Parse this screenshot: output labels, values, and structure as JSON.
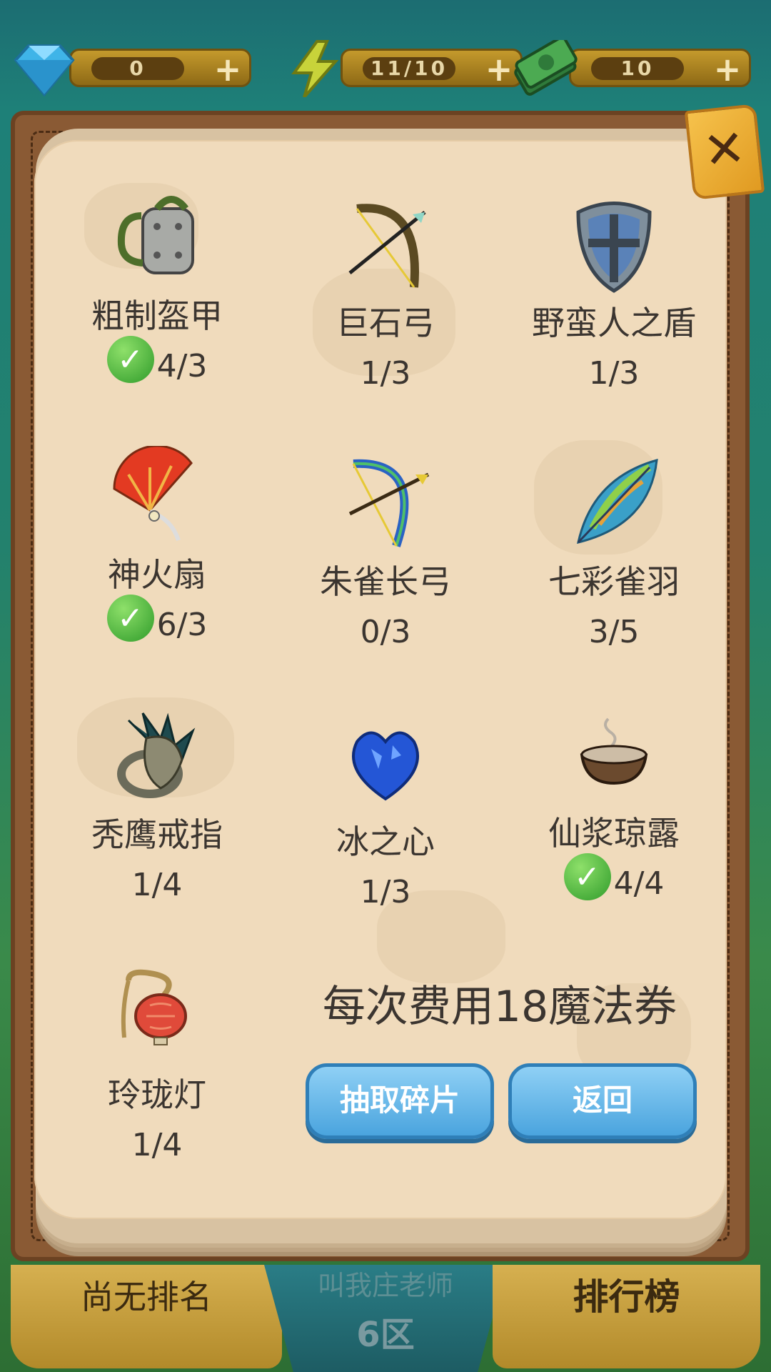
{
  "resources": [
    {
      "icon": "diamond-icon",
      "value": "0"
    },
    {
      "icon": "lightning-icon",
      "value": "11/10"
    },
    {
      "icon": "cash-icon",
      "value": "10"
    }
  ],
  "close": {
    "icon": "close-icon"
  },
  "items": [
    {
      "name": "粗制盔甲",
      "count": "4/3",
      "complete": true,
      "icon": "armor-icon"
    },
    {
      "name": "巨石弓",
      "count": "1/3",
      "complete": false,
      "icon": "bow-icon"
    },
    {
      "name": "野蛮人之盾",
      "count": "1/3",
      "complete": false,
      "icon": "shield-icon"
    },
    {
      "name": "神火扇",
      "count": "6/3",
      "complete": true,
      "icon": "fan-icon"
    },
    {
      "name": "朱雀长弓",
      "count": "0/3",
      "complete": false,
      "icon": "longbow-icon"
    },
    {
      "name": "七彩雀羽",
      "count": "3/5",
      "complete": false,
      "icon": "feather-icon"
    },
    {
      "name": "秃鹰戒指",
      "count": "1/4",
      "complete": false,
      "icon": "ring-icon"
    },
    {
      "name": "冰之心",
      "count": "1/3",
      "complete": false,
      "icon": "ice-heart-icon"
    },
    {
      "name": "仙浆琼露",
      "count": "4/4",
      "complete": true,
      "icon": "bowl-icon"
    },
    {
      "name": "玲珑灯",
      "count": "1/4",
      "complete": false,
      "icon": "lantern-icon"
    }
  ],
  "cost_text": "每次费用18魔法券",
  "buttons": {
    "draw": "抽取碎片",
    "back": "返回"
  },
  "bottom": {
    "left": "尚无排名",
    "mid_top": "叫我庄老师",
    "mid_bottom": "6区",
    "right": "排行榜"
  }
}
